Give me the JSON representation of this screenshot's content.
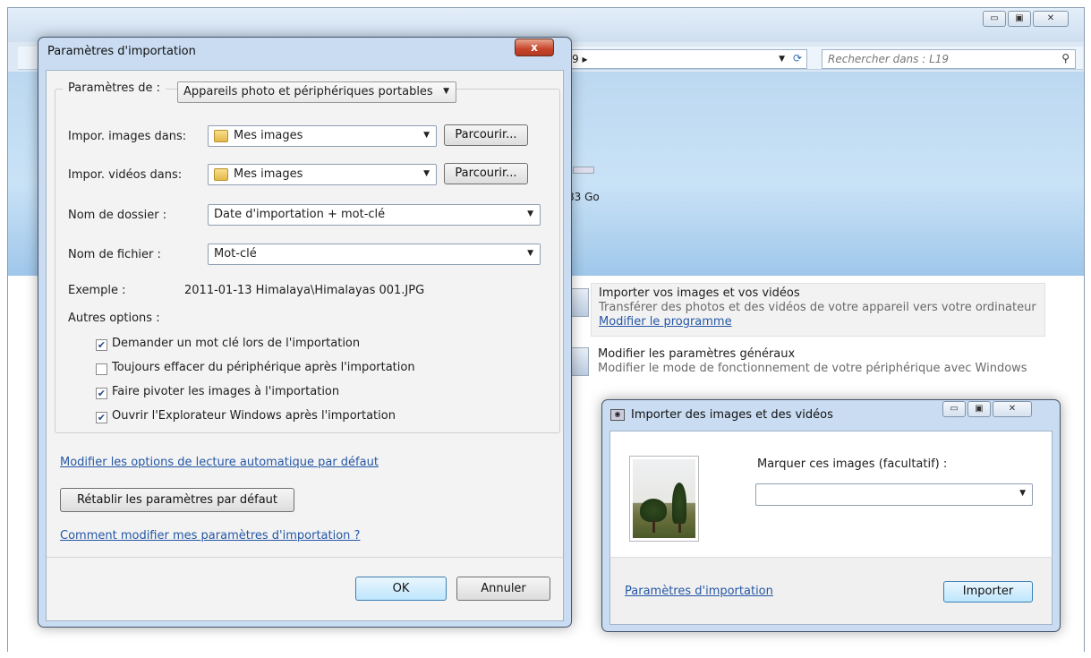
{
  "explorer": {
    "address_segment": "9",
    "search_placeholder": "Rechercher dans : L19",
    "storage_text": "83 Go",
    "tasks": [
      {
        "title": "Importer vos images et vos vidéos",
        "desc": "Transférer des photos et des vidéos de votre appareil vers votre ordinateur",
        "link": "Modifier le programme"
      },
      {
        "title": "Modifier les paramètres généraux",
        "desc": "Modifier le mode de fonctionnement de votre périphérique avec Windows"
      }
    ]
  },
  "import_settings": {
    "title": "Paramètres d'importation",
    "close_label": "x",
    "settings_for_label": "Paramètres de :",
    "settings_for_value": "Appareils photo et périphériques portables",
    "images_label": "Impor. images dans:",
    "images_value": "Mes images",
    "videos_label": "Impor. vidéos dans:",
    "videos_value": "Mes images",
    "browse_label": "Parcourir...",
    "folder_name_label": "Nom de dossier :",
    "folder_name_value": "Date d'importation + mot-clé",
    "file_name_label": "Nom de fichier :",
    "file_name_value": "Mot-clé",
    "example_label": "Exemple :",
    "example_value": "2011-01-13 Himalaya\\Himalayas 001.JPG",
    "other_options_label": "Autres options :",
    "options": [
      {
        "label": "Demander un mot clé lors de l'importation",
        "checked": true
      },
      {
        "label": "Toujours effacer du périphérique après l'importation",
        "checked": false
      },
      {
        "label": "Faire pivoter les images à l'importation",
        "checked": true
      },
      {
        "label": "Ouvrir l'Explorateur Windows après l'importation",
        "checked": true
      }
    ],
    "autoplay_link": "Modifier les options de lecture automatique par défaut",
    "reset_button": "Rétablir les paramètres par défaut",
    "help_link": "Comment modifier mes paramètres d'importation ?",
    "ok_button": "OK",
    "cancel_button": "Annuler"
  },
  "import_dialog": {
    "title": "Importer des images et des vidéos",
    "tag_label": "Marquer ces images (facultatif) :",
    "tag_value": "",
    "settings_link": "Paramètres d'importation",
    "import_button": "Importer"
  }
}
